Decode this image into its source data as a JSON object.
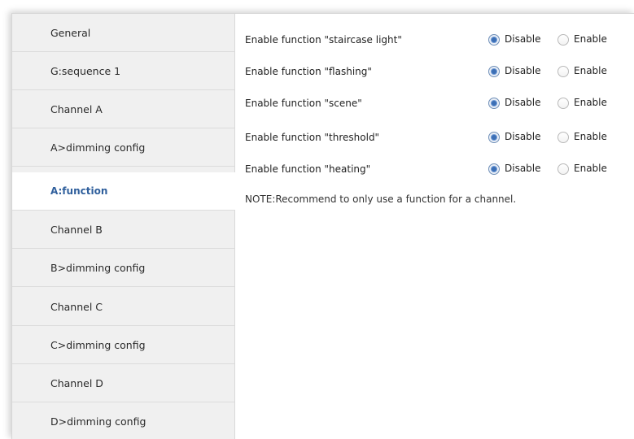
{
  "sidebar": {
    "items": [
      {
        "label": "General"
      },
      {
        "label": "G:sequence 1"
      },
      {
        "label": "Channel A"
      },
      {
        "label": "A>dimming config"
      },
      {
        "label": "A:function",
        "selected": true
      },
      {
        "label": "Channel B"
      },
      {
        "label": "B>dimming config"
      },
      {
        "label": "Channel C"
      },
      {
        "label": "C>dimming config"
      },
      {
        "label": "Channel D"
      },
      {
        "label": "D>dimming config"
      }
    ]
  },
  "content": {
    "rows": [
      {
        "label": "Enable function \"staircase light\"",
        "disable_label": "Disable",
        "enable_label": "Enable",
        "selected": "Disable"
      },
      {
        "label": "Enable function \"flashing\"",
        "disable_label": "Disable",
        "enable_label": "Enable",
        "selected": "Disable"
      },
      {
        "label": "Enable function \"scene\"",
        "disable_label": "Disable",
        "enable_label": "Enable",
        "selected": "Disable"
      },
      {
        "label": "Enable function \"threshold\"",
        "disable_label": "Disable",
        "enable_label": "Enable",
        "selected": "Disable"
      },
      {
        "label": "Enable function \"heating\"",
        "disable_label": "Disable",
        "enable_label": "Enable",
        "selected": "Disable"
      }
    ],
    "note": "NOTE:Recommend to only use a function for a channel."
  },
  "colors": {
    "selected_item_text": "#2f5f9c",
    "sidebar_background": "#f0f0f0",
    "radio_checked": "#3c6fb5"
  }
}
